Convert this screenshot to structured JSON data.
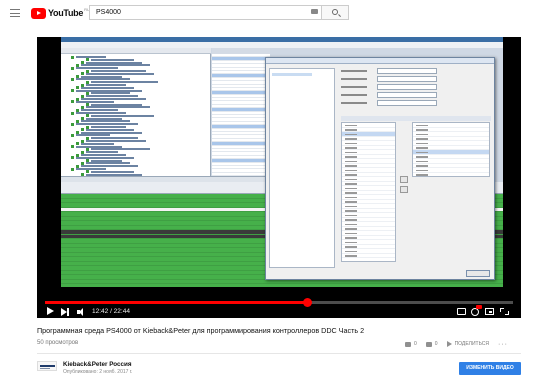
{
  "header": {
    "logo_text": "YouTube",
    "logo_region": "RU",
    "search_value": "PS4000",
    "icons": [
      "menu-icon",
      "youtube-logo",
      "keyboard-icon",
      "search-icon"
    ]
  },
  "player": {
    "time": "12:42 / 22:44",
    "progress_fraction": 0.56,
    "icons": [
      "play-icon",
      "next-icon",
      "volume-icon",
      "subtitles-icon",
      "settings-icon",
      "miniplayer-icon",
      "fullscreen-icon"
    ],
    "accent_color": "#ff0000"
  },
  "video": {
    "title": "Программная среда PS4000 от Kieback&Peter для программирования контроллеров DDC Часть 2",
    "views": "50 просмотров",
    "like_count": "0",
    "dislike_count": "0",
    "share_label": "ПОДЕЛИТЬСЯ"
  },
  "channel": {
    "name": "Kieback&Peter Россия",
    "published": "Опубликовано: 2 нояб. 2017 г.",
    "edit_button": "ИЗМЕНИТЬ ВИДЕО",
    "edit_button_color": "#2f80e6"
  }
}
